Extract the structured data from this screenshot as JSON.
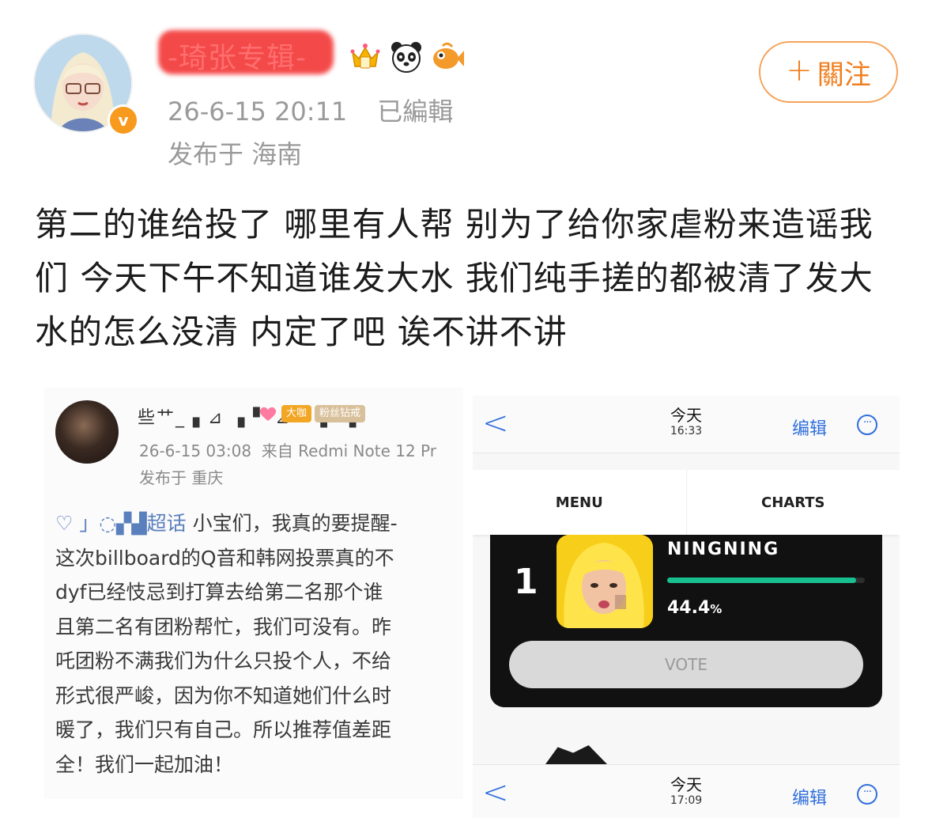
{
  "post": {
    "username": "-琦张专辑-",
    "timestamp": "26-6-15 20:11",
    "edited_label": "已編輯",
    "location": "发布于 海南",
    "follow_label": "關注",
    "follow_plus": "+",
    "verified_mark": "v",
    "badges": [
      "crown-badge-icon",
      "panda-badge-icon",
      "fish-badge-icon"
    ],
    "text": "第二的谁给投了 哪里有人帮 别为了给你家虐粉来造谣我们 今天下午不知道谁发大水 我们纯手搓的都被清了发大水的怎么没清 内定了吧 诶不讲不讲"
  },
  "embedded_post": {
    "username": "些艹_ ▖⊿ ▗ ▘ ⊿ ▘ ▖ ▗",
    "timestamp": "26-6-15 03:08",
    "device": "来自 Redmi Note 12 Pr",
    "location": "发布于 重庆",
    "badges": [
      "大咖",
      "粉丝钻戒"
    ],
    "lines": [
      {
        "topic": "♡ 」◌▞▟超话",
        "text": " 小宝们，我真的要提醒-"
      },
      {
        "topic": "",
        "text": "这次billboard的Q音和韩网投票真的不"
      },
      {
        "topic": "",
        "text": "dyf已经忮忌到打算去给第二名那个谁"
      },
      {
        "topic": "",
        "text": "且第二名有团粉帮忙，我们可没有。昨"
      },
      {
        "topic": "",
        "text": "吒团粉不满我们为什么只投个人，不给"
      },
      {
        "topic": "",
        "text": "形式很严峻，因为你不知道她们什么时"
      },
      {
        "topic": "",
        "text": "暖了，我们只有自己。所以推荐值差距"
      },
      {
        "topic": "",
        "text": "全！我们一起加油！"
      }
    ]
  },
  "vote_screenshot": {
    "top_bar": {
      "back": "<",
      "day": "今天",
      "time": "16:33",
      "edit": "编辑",
      "more": "···"
    },
    "tabs": [
      "MENU",
      "CHARTS"
    ],
    "rank": "1",
    "artist": "NINGNING",
    "percent_value": "44.4",
    "percent_unit": "%",
    "progress": 0.444,
    "vote_label": "VOTE",
    "bottom_bar": {
      "back": "<",
      "day": "今天",
      "time": "17:09",
      "edit": "编辑",
      "more": "···"
    }
  },
  "colors": {
    "follow_accent": "#f07f1f",
    "verified": "#f79a1e",
    "ios_blue": "#2f6fdc",
    "progress_green": "#19c08f",
    "redaction": "#f33a3a"
  }
}
